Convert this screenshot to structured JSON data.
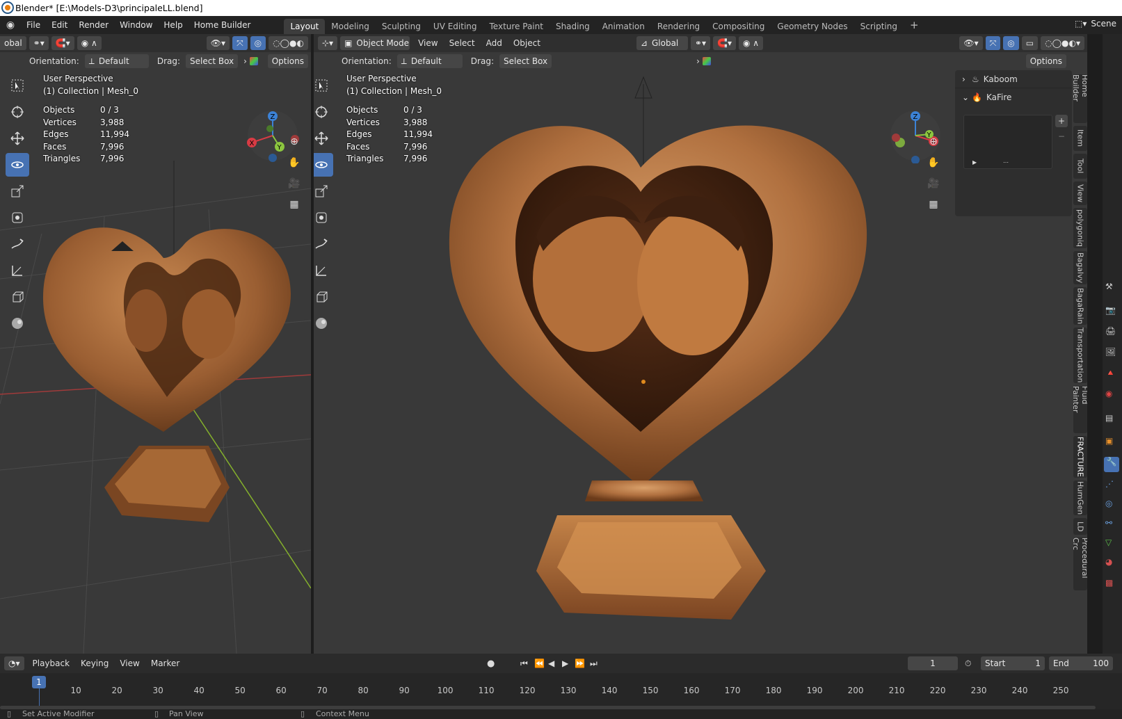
{
  "window": {
    "title": "Blender* [E:\\Models-D3\\principaleLL.blend]"
  },
  "menubar": {
    "menus": [
      "File",
      "Edit",
      "Render",
      "Window",
      "Help",
      "Home Builder"
    ],
    "workspaces": [
      "Layout",
      "Modeling",
      "Sculpting",
      "UV Editing",
      "Texture Paint",
      "Shading",
      "Animation",
      "Rendering",
      "Compositing",
      "Geometry Nodes",
      "Scripting"
    ],
    "active_workspace": "Layout",
    "scene": "Scene"
  },
  "left_viewport": {
    "transform_partial": "obal",
    "orientation_label": "Orientation:",
    "orientation_value": "Default",
    "drag_label": "Drag:",
    "drag_value": "Select Box",
    "options": "Options",
    "overlay_title": "User Perspective",
    "overlay_collection": "(1) Collection | Mesh_0",
    "stats": [
      {
        "k": "Objects",
        "v": "0 / 3"
      },
      {
        "k": "Vertices",
        "v": "3,988"
      },
      {
        "k": "Edges",
        "v": "11,994"
      },
      {
        "k": "Faces",
        "v": "7,996"
      },
      {
        "k": "Triangles",
        "v": "7,996"
      }
    ]
  },
  "main_viewport": {
    "mode": "Object Mode",
    "menus": [
      "View",
      "Select",
      "Add",
      "Object"
    ],
    "transform": "Global",
    "orientation_label": "Orientation:",
    "orientation_value": "Default",
    "drag_label": "Drag:",
    "drag_value": "Select Box",
    "options": "Options",
    "overlay_title": "User Perspective",
    "overlay_collection": "(1) Collection | Mesh_0",
    "stats": [
      {
        "k": "Objects",
        "v": "0 / 3"
      },
      {
        "k": "Vertices",
        "v": "3,988"
      },
      {
        "k": "Edges",
        "v": "11,994"
      },
      {
        "k": "Faces",
        "v": "7,996"
      },
      {
        "k": "Triangles",
        "v": "7,996"
      }
    ]
  },
  "npanel": {
    "panels": [
      "Kaboom",
      "KaFire"
    ],
    "tabs": [
      "Home Builder",
      "Item",
      "Tool",
      "View",
      "polygoniq",
      "Bagalvy",
      "BagaRain",
      "Transportation",
      "Fluid Painter",
      "FRACTURE",
      "HumGen",
      "LD",
      "Procedural Crc"
    ]
  },
  "gizmo_axes": {
    "x": "X",
    "y": "Y",
    "z": "Z"
  },
  "timeline": {
    "menus": [
      "Playback",
      "Keying",
      "View",
      "Marker"
    ],
    "current_frame": "1",
    "start_label": "Start",
    "start": "1",
    "end_label": "End",
    "end": "100",
    "frame_marker": "1",
    "ticks": [
      "10",
      "20",
      "30",
      "40",
      "50",
      "60",
      "70",
      "80",
      "90",
      "100",
      "110",
      "120",
      "130",
      "140",
      "150",
      "160",
      "170",
      "180",
      "190",
      "200",
      "210",
      "220",
      "230",
      "240",
      "250"
    ]
  },
  "statusbar": {
    "items": [
      "Set Active Modifier",
      "Pan View",
      "Context Menu"
    ]
  },
  "colors": {
    "accent": "#4772b3",
    "x_axis": "#d83b44",
    "y_axis": "#8cc63f",
    "z_axis": "#3c82d6",
    "wood": "#b0703f"
  }
}
